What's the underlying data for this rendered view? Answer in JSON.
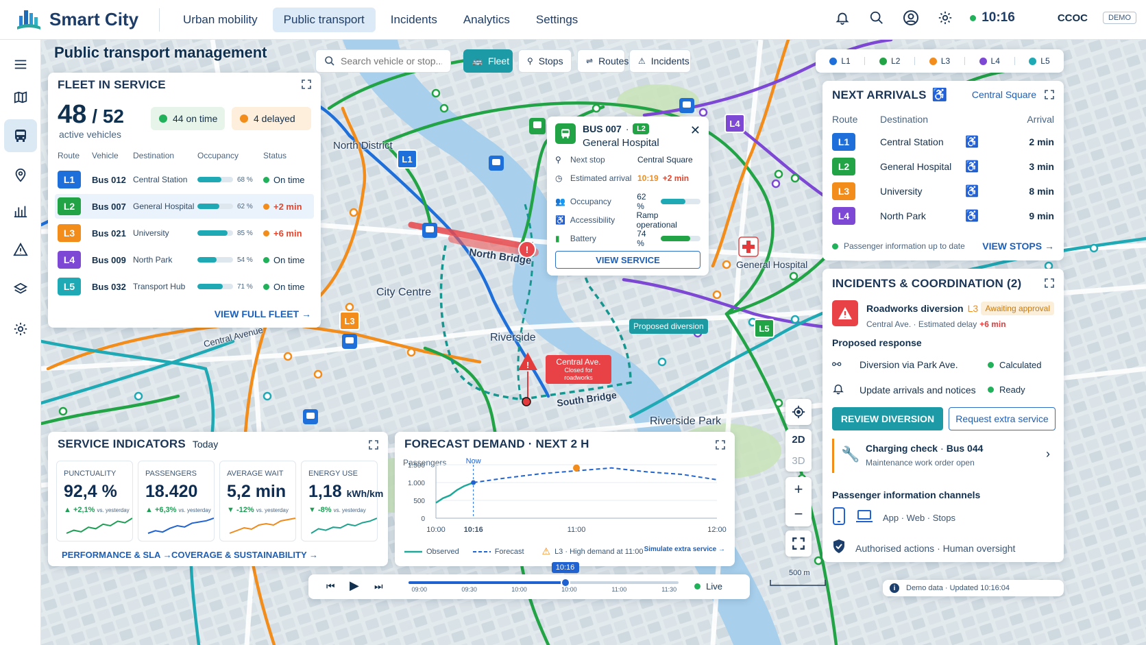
{
  "app": {
    "title": "Smart City"
  },
  "nav": {
    "items": [
      "Urban mobility",
      "Public transport",
      "Incidents",
      "Analytics",
      "Settings"
    ],
    "active": 1
  },
  "topbar": {
    "time": "10:16",
    "user": "CCOC",
    "demo": "DEMO"
  },
  "page": {
    "title": "Public transport management"
  },
  "search": {
    "placeholder": "Search vehicle or stop..."
  },
  "layers": [
    {
      "label": "Fleet",
      "active": true
    },
    {
      "label": "Stops"
    },
    {
      "label": "Routes"
    },
    {
      "label": "Incidents"
    }
  ],
  "lines": [
    {
      "id": "L1",
      "color": "#1e6fd9"
    },
    {
      "id": "L2",
      "color": "#22a346"
    },
    {
      "id": "L3",
      "color": "#f28c1b"
    },
    {
      "id": "L4",
      "color": "#7d48d4"
    },
    {
      "id": "L5",
      "color": "#1fa9b4"
    }
  ],
  "fleet": {
    "title": "FLEET IN SERVICE",
    "active": "48",
    "total": "/ 52",
    "active_label": "active vehicles",
    "on_time": "44 on time",
    "delayed": "4 delayed",
    "columns": [
      "Route",
      "Vehicle",
      "Destination",
      "Occupancy",
      "Status"
    ],
    "rows": [
      {
        "route": "L1",
        "vehicle": "Bus 012",
        "destination": "Central Station",
        "occupancy": 68,
        "occ_label": "68 %",
        "status": "On time",
        "delay": false
      },
      {
        "route": "L2",
        "vehicle": "Bus 007",
        "destination": "General Hospital",
        "occupancy": 62,
        "occ_label": "62 %",
        "status": "+2 min",
        "delay": true
      },
      {
        "route": "L3",
        "vehicle": "Bus 021",
        "destination": "University",
        "occupancy": 85,
        "occ_label": "85 %",
        "status": "+6 min",
        "delay": true
      },
      {
        "route": "L4",
        "vehicle": "Bus 009",
        "destination": "North Park",
        "occupancy": 54,
        "occ_label": "54 %",
        "status": "On time",
        "delay": false
      },
      {
        "route": "L5",
        "vehicle": "Bus 032",
        "destination": "Transport Hub",
        "occupancy": 71,
        "occ_label": "71 %",
        "status": "On time",
        "delay": false
      }
    ],
    "view_all": "VIEW FULL FLEET →"
  },
  "map_labels": {
    "north_district": "North District",
    "north_bridge": "North Bridge",
    "city_centre": "City Centre",
    "riverside": "Riverside",
    "central_avenue": "Central Avenue",
    "south_bridge": "South Bridge",
    "riverside_park": "Riverside Park",
    "general_hospital": "General Hospital",
    "scale": "500 m"
  },
  "callouts": {
    "closure_title": "Central Ave.",
    "closure_sub": "Closed for roadworks",
    "diversion": "Proposed diversion"
  },
  "bus_popup": {
    "title": "BUS 007",
    "line": "L2",
    "destination": "General Hospital",
    "rows": [
      {
        "label": "Next stop",
        "value": "Central Square"
      },
      {
        "label": "Estimated arrival",
        "value": "10:19",
        "delay": "+2 min"
      },
      {
        "label": "Occupancy",
        "value": "62 %",
        "bar": 62
      },
      {
        "label": "Accessibility",
        "value": "Ramp operational"
      },
      {
        "label": "Battery",
        "value": "74 %",
        "bar": 74
      }
    ],
    "button": "VIEW SERVICE"
  },
  "arrivals": {
    "title": "NEXT ARRIVALS",
    "stop": "Central Square",
    "columns": [
      "Route",
      "Destination",
      "Arrival"
    ],
    "rows": [
      {
        "route": "L1",
        "destination": "Central Station",
        "arrival": "2 min"
      },
      {
        "route": "L2",
        "destination": "General Hospital",
        "arrival": "3 min"
      },
      {
        "route": "L3",
        "destination": "University",
        "arrival": "8 min"
      },
      {
        "route": "L4",
        "destination": "North Park",
        "arrival": "9 min"
      }
    ],
    "footer": "Passenger information up to date",
    "view_stops": "VIEW STOPS →"
  },
  "incidents": {
    "title": "INCIDENTS & COORDINATION (2)",
    "main": {
      "title": "Roadworks diversion",
      "line": "L3",
      "badge": "Awaiting approval",
      "sub": "Central Ave.  ·  Estimated delay",
      "delay": "+6 min"
    },
    "response_title": "Proposed response",
    "responses": [
      {
        "label": "Diversion via Park Ave.",
        "status": "Calculated"
      },
      {
        "label": "Update arrivals and notices",
        "status": "Ready"
      }
    ],
    "btn_review": "REVIEW DIVERSION",
    "btn_extra": "Request extra service",
    "second": {
      "title": "Charging check",
      "vehicle": "Bus 044",
      "sub": "Maintenance work order open"
    },
    "channels_title": "Passenger information channels",
    "channels": "App  ·  Web  ·  Stops",
    "authorised": "Authorised actions · Human oversight"
  },
  "indicators": {
    "title": "SERVICE INDICATORS",
    "period": "Today",
    "kpis": [
      {
        "label": "PUNCTUALITY",
        "value": "92,4 %",
        "delta": "▲ +2,1%",
        "vs": "vs. yesterday",
        "color": "#1e9e55",
        "spark": [
          3,
          4,
          3.5,
          5,
          4.5,
          6,
          5.5,
          7,
          6.5,
          8
        ]
      },
      {
        "label": "PASSENGERS",
        "value": "18.420",
        "delta": "▲ +6,3%",
        "vs": "vs. yesterday",
        "color": "#2063d0",
        "spark": [
          2,
          3,
          2.5,
          4,
          5,
          4.5,
          6,
          6.5,
          7,
          8
        ]
      },
      {
        "label": "AVERAGE WAIT",
        "value": "5,2 min",
        "delta": "▼ -12%",
        "vs": "vs. yesterday",
        "color": "#ef8a1c",
        "spark": [
          2,
          3,
          4,
          3.5,
          5,
          5.5,
          5,
          6.5,
          7,
          7.5
        ]
      },
      {
        "label": "ENERGY USE",
        "value": "1,18",
        "unit": "kWh/km",
        "delta": "▼ -8%",
        "vs": "vs. yesterday",
        "color": "#1fa28e",
        "spark": [
          3,
          4.5,
          4,
          5,
          4.8,
          6,
          5.5,
          6.5,
          7,
          8
        ]
      }
    ],
    "link1": "PERFORMANCE & SLA →",
    "link2": "COVERAGE & SUSTAINABILITY →"
  },
  "forecast": {
    "title": "FORECAST DEMAND · NEXT 2 H",
    "legend_observed": "Observed",
    "legend_forecast": "Forecast",
    "alert": "L3 · High demand at 11:00",
    "simulate": "Simulate extra service →"
  },
  "chart_data": {
    "type": "line",
    "ylabel": "Passengers",
    "ylim": [
      0,
      1500
    ],
    "yticks": [
      "1.500",
      "1.000",
      "500",
      "0"
    ],
    "xticks": [
      "10:00",
      "10:16",
      "11:00",
      "12:00"
    ],
    "now_label": "Now",
    "series": [
      {
        "name": "Observed",
        "x": [
          0,
          3,
          6,
          9,
          12,
          16
        ],
        "y": [
          430,
          560,
          640,
          790,
          900,
          1000
        ]
      },
      {
        "name": "Forecast",
        "x": [
          16,
          30,
          45,
          60,
          75,
          90,
          105,
          120
        ],
        "y": [
          1000,
          1130,
          1250,
          1330,
          1410,
          1300,
          1230,
          1080
        ]
      }
    ],
    "x_minutes_ticks": [
      0,
      16,
      60,
      120
    ],
    "peak": {
      "x": 60,
      "y": 1410
    }
  },
  "timeline": {
    "current": "10:16",
    "ticks": [
      "09:00",
      "09:30",
      "10:00",
      "10:00",
      "11:00",
      "11:30"
    ],
    "live": "Live",
    "position": 0.58
  },
  "map_controls": {
    "d2": "2D",
    "d3": "3D",
    "plus": "+",
    "minus": "−"
  },
  "footer": {
    "text": "Demo data · Updated 10:16:04"
  }
}
